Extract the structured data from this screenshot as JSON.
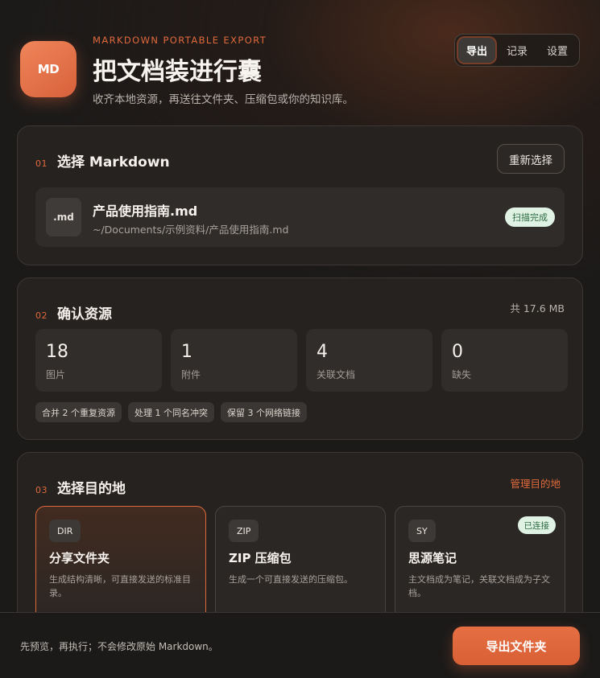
{
  "header": {
    "logo_text": "MD",
    "eyebrow": "MARKDOWN PORTABLE EXPORT",
    "title": "把文档装进行囊",
    "subtitle": "收齐本地资源，再送往文件夹、压缩包或你的知识库。"
  },
  "nav": {
    "tabs": [
      "导出",
      "记录",
      "设置"
    ],
    "active": 0
  },
  "colors": {
    "accent": "#e0693c",
    "success_bg": "#dff2e4",
    "success_text": "#2d6a40",
    "background": "#1c1a19"
  },
  "section1": {
    "num": "01",
    "title": "选择 Markdown",
    "action": "重新选择",
    "file": {
      "ext": ".md",
      "name": "产品使用指南.md",
      "path": "~/Documents/示例资料/产品使用指南.md",
      "status": "扫描完成"
    }
  },
  "section2": {
    "num": "02",
    "title": "确认资源",
    "total": "共 17.6 MB",
    "stats": [
      {
        "value": "18",
        "label": "图片"
      },
      {
        "value": "1",
        "label": "附件"
      },
      {
        "value": "4",
        "label": "关联文档"
      },
      {
        "value": "0",
        "label": "缺失"
      }
    ],
    "chips": [
      "合并 2 个重复资源",
      "处理 1 个同名冲突",
      "保留 3 个网络链接"
    ]
  },
  "section3": {
    "num": "03",
    "title": "选择目的地",
    "action": "管理目的地",
    "destinations": [
      {
        "tag": "DIR",
        "title": "分享文件夹",
        "desc": "生成结构清晰，可直接发送的标准目录。",
        "selected": true
      },
      {
        "tag": "ZIP",
        "title": "ZIP 压缩包",
        "desc": "生成一个可直接发送的压缩包。",
        "selected": false
      },
      {
        "tag": "SY",
        "title": "思源笔记",
        "desc": "主文档成为笔记，关联文档成为子文档。",
        "badge": "已连接",
        "selected": false
      }
    ]
  },
  "footer": {
    "note": "先预览，再执行；不会修改原始 Markdown。",
    "primary": "导出文件夹"
  }
}
